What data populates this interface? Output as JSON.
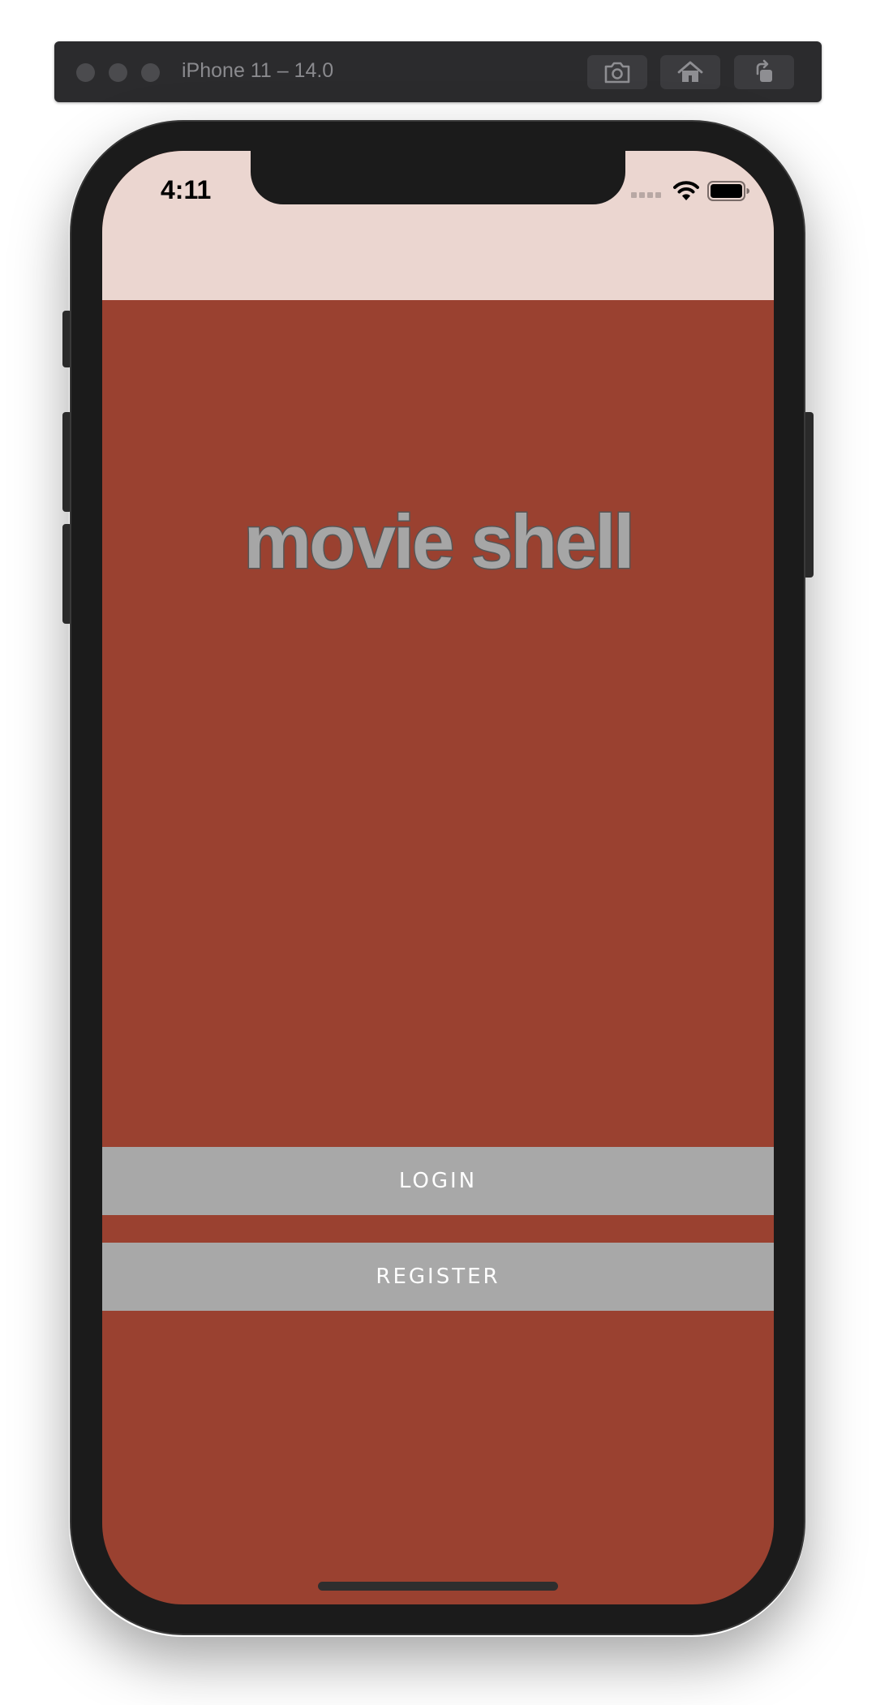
{
  "simulator": {
    "title": "iPhone 11 – 14.0",
    "buttons": [
      {
        "icon": "screenshot-icon"
      },
      {
        "icon": "home-icon"
      },
      {
        "icon": "rotate-icon"
      }
    ]
  },
  "status_bar": {
    "time": "4:11",
    "icons": [
      "cellular-signal-icon",
      "wifi-icon",
      "battery-icon"
    ]
  },
  "app": {
    "title": "movie shell",
    "login_label": "Login",
    "register_label": "Register"
  },
  "colors": {
    "status_area": "#ebd6d0",
    "background": "#9a4130",
    "button": "#a8a8a8",
    "title_text": "#a6a6a6"
  }
}
